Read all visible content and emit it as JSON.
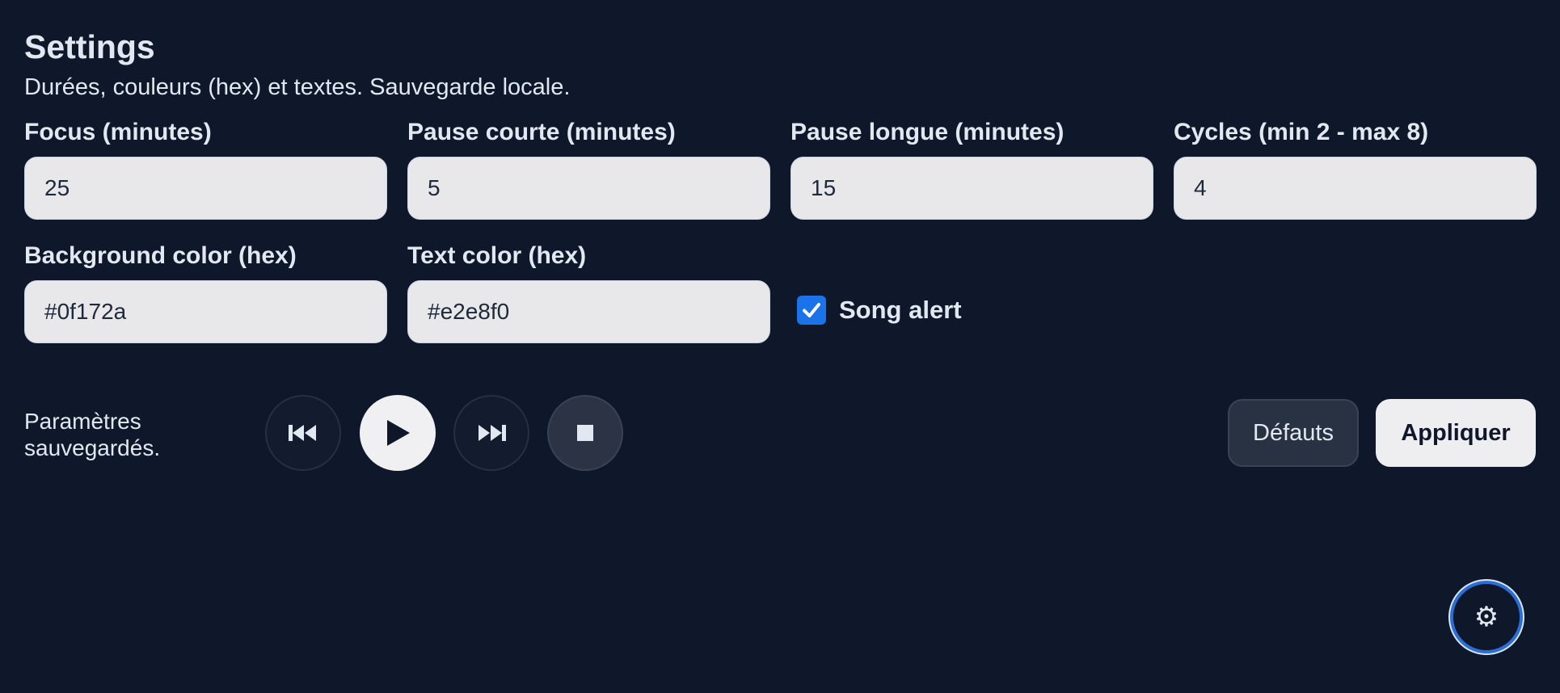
{
  "header": {
    "title": "Settings",
    "subtitle": "Durées, couleurs (hex) et textes. Sauvegarde locale."
  },
  "fields": {
    "focus": {
      "label": "Focus (minutes)",
      "value": "25"
    },
    "short_break": {
      "label": "Pause courte (minutes)",
      "value": "5"
    },
    "long_break": {
      "label": "Pause longue (minutes)",
      "value": "15"
    },
    "cycles": {
      "label": "Cycles (min 2 - max 8)",
      "value": "4"
    },
    "background_color": {
      "label": "Background color (hex)",
      "value": "#0f172a"
    },
    "text_color": {
      "label": "Text color (hex)",
      "value": "#e2e8f0"
    }
  },
  "song_alert": {
    "label": "Song alert",
    "checked": true
  },
  "status": {
    "text": "Paramètres sauvegardés."
  },
  "media": {
    "previous_icon": "skip-previous-icon",
    "play_icon": "play-icon",
    "next_icon": "skip-next-icon",
    "stop_icon": "stop-icon"
  },
  "actions": {
    "defaults_label": "Défauts",
    "apply_label": "Appliquer"
  },
  "settings_button": {
    "icon": "gear-icon",
    "glyph": "⚙"
  },
  "colors": {
    "background": "#0f172a",
    "text": "#e2e8f0",
    "checkbox_accent": "#1a73e8",
    "gear_ring": "#2b6fd6"
  }
}
